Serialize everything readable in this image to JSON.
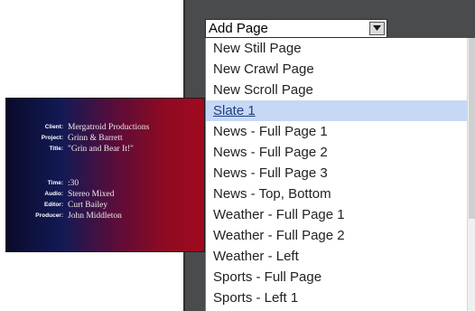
{
  "slate": {
    "rows": [
      {
        "label": "Client:",
        "value": "Mergatroid Productions"
      },
      {
        "label": "Project:",
        "value": "Grinn & Barrett"
      },
      {
        "label": "Title:",
        "value": "\"Grin and Bear It!\""
      },
      {
        "label": "Time:",
        "value": ":30"
      },
      {
        "label": "Audio:",
        "value": "Stereo Mixed"
      },
      {
        "label": "Editor:",
        "value": "Curt Bailey"
      },
      {
        "label": "Producer:",
        "value": "John Middleton"
      }
    ]
  },
  "dropdown": {
    "selected_value": "Add Page",
    "arrow_icon": "chevron-down-icon",
    "options": [
      "New Still Page",
      "New Crawl Page",
      "New Scroll Page",
      "Slate 1",
      "News - Full Page 1",
      "News - Full Page 2",
      "News - Full Page 3",
      "News - Top, Bottom",
      "Weather - Full Page 1",
      "Weather - Full Page 2",
      "Weather - Left",
      "Sports - Full Page",
      "Sports - Left 1"
    ],
    "highlighted_option": "Slate 1"
  },
  "colors": {
    "panel_background": "#4a4b4d",
    "highlight": "#c7d8f6"
  }
}
